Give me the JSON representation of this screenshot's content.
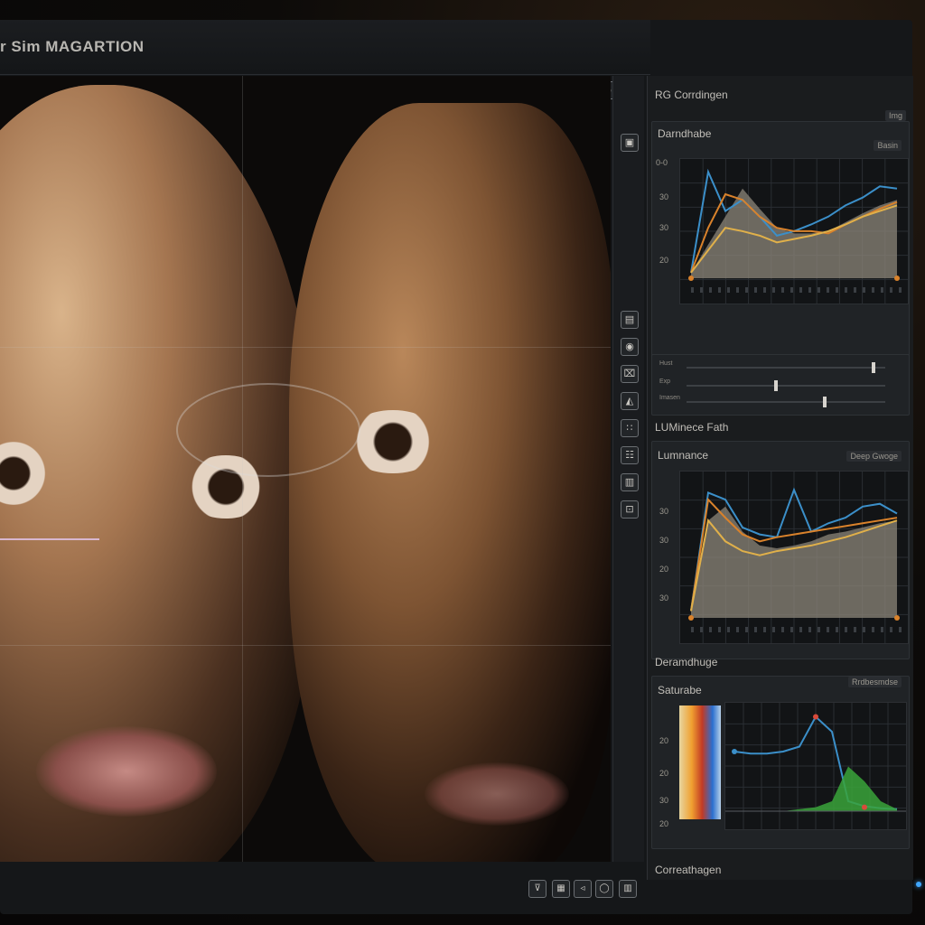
{
  "app": {
    "title": "r Sim MAGARTION"
  },
  "toolbar_top": {
    "btn1": "◎",
    "btn2": "⊙",
    "btn3": "▣"
  },
  "left_tools": [
    "▤",
    "◉",
    "⌧",
    "◭",
    "∷",
    "☷",
    "▥",
    "⊡"
  ],
  "bottom_tools": [
    "⊽",
    "▦",
    "◃",
    "◯",
    "▥"
  ],
  "panel": {
    "header": "RG Corrdingen",
    "header_pill": "Img",
    "section1": {
      "title": "Darndhabe",
      "pill": "Basin",
      "y_ticks": [
        "0-0",
        "30",
        "30",
        "20"
      ]
    },
    "sliders": [
      {
        "label": "Hust",
        "value": 0.95
      },
      {
        "label": "Exp",
        "value": 0.45
      },
      {
        "label": "Imasen",
        "value": 0.7
      }
    ],
    "luminance_header": "LUMinece Fath",
    "section2": {
      "title": "Lumnance",
      "pill": "Deep Gwoge",
      "y_ticks": [
        "30",
        "30",
        "20",
        "30"
      ]
    },
    "section3_header": "Deramdhuge",
    "section3": {
      "title": "Saturabe",
      "pill": "Rrdbesmdse",
      "y_ticks": [
        "20",
        "20",
        "30",
        "20"
      ]
    },
    "footer": "Correathagen"
  },
  "colors": {
    "blue": "#3b8fc9",
    "orange": "#d9822b",
    "gold": "#e0b04a",
    "gray_fill": "#8c857a",
    "green": "#3aa33a",
    "red": "#d84a3a",
    "led": "#3fa7ff"
  },
  "chart_data": [
    {
      "type": "area",
      "x": [
        0,
        1,
        2,
        3,
        4,
        5,
        6,
        7,
        8,
        9,
        10,
        11,
        12
      ],
      "ylim": [
        0,
        100
      ],
      "series": [
        {
          "values": [
            5,
            30,
            55,
            80,
            62,
            45,
            40,
            40,
            42,
            50,
            58,
            65,
            70
          ]
        },
        {
          "values": [
            5,
            95,
            60,
            70,
            55,
            38,
            42,
            48,
            55,
            65,
            72,
            82,
            80
          ]
        },
        {
          "values": [
            5,
            45,
            75,
            70,
            55,
            45,
            42,
            42,
            40,
            48,
            55,
            62,
            68
          ]
        },
        {
          "values": [
            5,
            25,
            45,
            42,
            38,
            32,
            35,
            38,
            42,
            48,
            55,
            60,
            65
          ]
        }
      ]
    },
    {
      "type": "area",
      "x": [
        0,
        1,
        2,
        3,
        4,
        5,
        6,
        7,
        8,
        9,
        10,
        11,
        12
      ],
      "ylim": [
        0,
        100
      ],
      "series": [
        {
          "values": [
            5,
            70,
            80,
            62,
            52,
            50,
            52,
            55,
            60,
            62,
            65,
            68,
            70
          ]
        },
        {
          "values": [
            5,
            90,
            85,
            65,
            60,
            58,
            92,
            62,
            68,
            72,
            80,
            82,
            75
          ]
        },
        {
          "values": [
            5,
            85,
            72,
            60,
            55,
            58,
            60,
            62,
            64,
            66,
            68,
            70,
            72
          ]
        },
        {
          "values": [
            5,
            70,
            55,
            48,
            45,
            48,
            50,
            52,
            55,
            58,
            62,
            66,
            70
          ]
        }
      ]
    },
    {
      "type": "line",
      "x": [
        0,
        1,
        2,
        3,
        4,
        5,
        6,
        7,
        8,
        9,
        10
      ],
      "ylim": [
        0,
        100
      ],
      "series": [
        {
          "values": [
            60,
            58,
            58,
            60,
            65,
            95,
            80,
            10,
            5,
            3,
            2
          ]
        },
        {
          "values": [
            0,
            0,
            0,
            0,
            2,
            4,
            10,
            45,
            30,
            10,
            2
          ]
        }
      ]
    }
  ]
}
